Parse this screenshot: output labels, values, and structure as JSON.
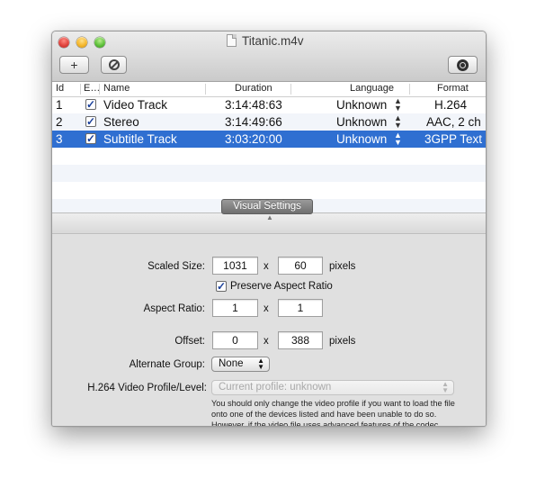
{
  "window": {
    "title": "Titanic.m4v"
  },
  "toolbar": {
    "add_icon": "plus-icon",
    "disable_icon": "disable-icon",
    "inspector_icon": "inspector-icon"
  },
  "table": {
    "columns": [
      "Id",
      "E…",
      "Name",
      "Duration",
      "Language",
      "Format"
    ],
    "rows": [
      {
        "id": "1",
        "enabled": true,
        "name": "Video Track",
        "duration": "3:14:48:63",
        "language": "Unknown",
        "format": "H.264"
      },
      {
        "id": "2",
        "enabled": true,
        "name": "Stereo",
        "duration": "3:14:49:66",
        "language": "Unknown",
        "format": "AAC, 2 ch"
      },
      {
        "id": "3",
        "enabled": true,
        "name": "Subtitle Track",
        "duration": "3:03:20:00",
        "language": "Unknown",
        "format": "3GPP Text",
        "selected": true
      }
    ]
  },
  "settings": {
    "section_button": "Visual Settings",
    "scaled_size_label": "Scaled Size:",
    "scaled_width": "1031",
    "scaled_height": "60",
    "times": "x",
    "pixels": "pixels",
    "preserve_label": "Preserve Aspect Ratio",
    "preserve_checked": true,
    "aspect_label": "Aspect Ratio:",
    "aspect_w": "1",
    "aspect_h": "1",
    "offset_label": "Offset:",
    "offset_x": "0",
    "offset_y": "388",
    "alt_group_label": "Alternate Group:",
    "alt_group_value": "None",
    "profile_label": "H.264 Video Profile/Level:",
    "profile_value": "Current profile: unknown",
    "help_text": "You should only change the video profile if you want to load the file onto one of the devices listed and have been unable to do so.  However, if the video file uses advanced features of the codec, then the file may still be unplayable on the device."
  },
  "colors": {
    "selection": "#2f6fd1",
    "window_bg": "#e0e0e0"
  }
}
